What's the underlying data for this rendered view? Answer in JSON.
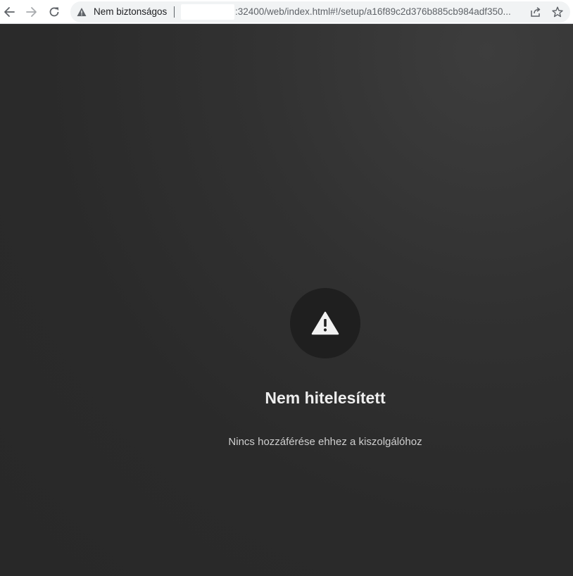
{
  "browser": {
    "security_label": "Nem biztonságos",
    "url_text": ":32400/web/index.html#!/setup/a16f89c2d376b885cb984adf350...",
    "icons": {
      "back": "arrow-left-icon",
      "forward": "arrow-right-icon",
      "reload": "reload-icon",
      "security": "warning-triangle-icon",
      "share": "share-icon",
      "bookmark": "star-icon"
    }
  },
  "page": {
    "icon": "warning-triangle-icon",
    "title": "Nem hitelesített",
    "message": "Nincs hozzáférése ehhez a kiszolgálóhoz"
  },
  "colors": {
    "background": "#2c2c2c",
    "icon_circle": "#1f1f1f",
    "title_text": "#eeeeee",
    "message_text": "#cfcfcf"
  }
}
